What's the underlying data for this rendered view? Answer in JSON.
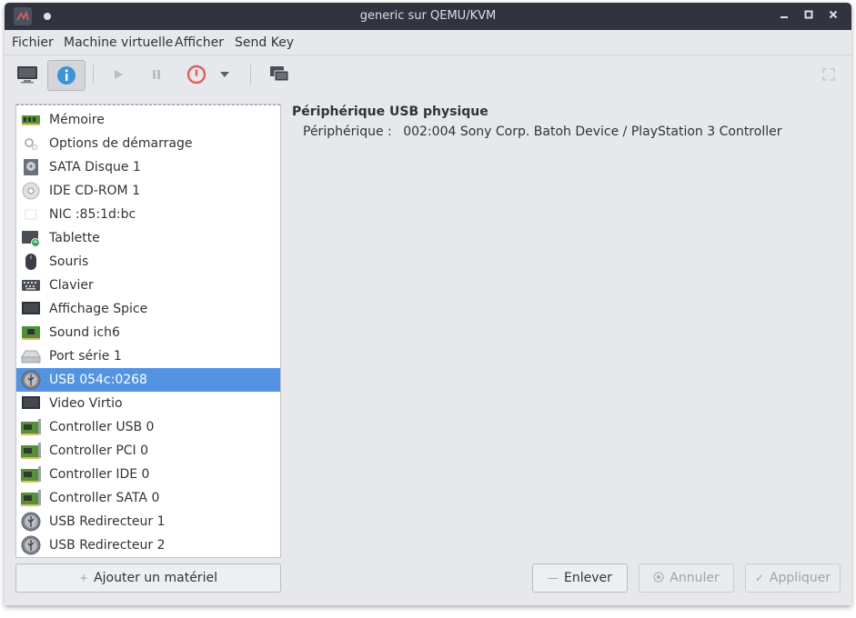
{
  "window": {
    "title": "generic sur QEMU/KVM"
  },
  "menu": [
    "Fichier",
    "Machine virtuelle",
    "Afficher",
    "Send Key"
  ],
  "toolbar": {
    "icons": [
      "monitor-icon",
      "info-icon",
      "play-icon",
      "pause-icon",
      "power-icon",
      "dropdown-icon",
      "clone-icon",
      "fullscreen-icon"
    ]
  },
  "hardware": {
    "items": [
      {
        "label": "Mémoire",
        "icon": "memory-icon"
      },
      {
        "label": "Options de démarrage",
        "icon": "boot-options-icon"
      },
      {
        "label": "SATA Disque 1",
        "icon": "disk-icon"
      },
      {
        "label": "IDE CD-ROM 1",
        "icon": "cdrom-icon"
      },
      {
        "label": "NIC :85:1d:bc",
        "icon": "nic-icon"
      },
      {
        "label": "Tablette",
        "icon": "tablet-icon"
      },
      {
        "label": "Souris",
        "icon": "mouse-icon"
      },
      {
        "label": "Clavier",
        "icon": "keyboard-icon"
      },
      {
        "label": "Affichage Spice",
        "icon": "display-icon"
      },
      {
        "label": "Sound ich6",
        "icon": "sound-card-icon"
      },
      {
        "label": "Port série 1",
        "icon": "serial-port-icon"
      },
      {
        "label": "USB 054c:0268",
        "icon": "usb-icon"
      },
      {
        "label": "Video Virtio",
        "icon": "video-icon"
      },
      {
        "label": "Controller USB 0",
        "icon": "controller-icon"
      },
      {
        "label": "Controller PCI 0",
        "icon": "controller-icon"
      },
      {
        "label": "Controller IDE 0",
        "icon": "controller-icon"
      },
      {
        "label": "Controller SATA 0",
        "icon": "controller-icon"
      },
      {
        "label": "USB Redirecteur 1",
        "icon": "usb-icon"
      },
      {
        "label": "USB Redirecteur 2",
        "icon": "usb-icon"
      }
    ],
    "selected_index": 11
  },
  "details": {
    "heading": "Périphérique USB physique",
    "device_label": "Périphérique :",
    "device_value": "002:004 Sony Corp. Batoh Device / PlayStation 3 Controller"
  },
  "buttons": {
    "add_hardware": "Ajouter un matériel",
    "remove": "Enlever",
    "cancel": "Annuler",
    "apply": "Appliquer"
  },
  "colors": {
    "accent": "#5294e2",
    "titlebar": "#2f343f",
    "power": "#e05c5c"
  }
}
